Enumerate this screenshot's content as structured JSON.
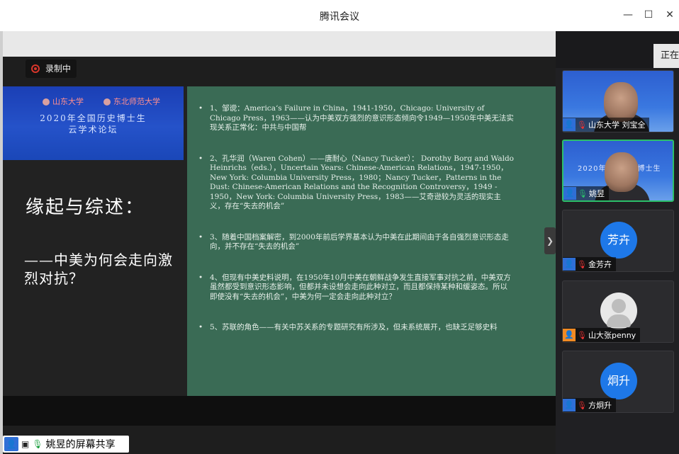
{
  "window": {
    "title": "腾讯会议"
  },
  "recording": {
    "label": "录制中"
  },
  "slide": {
    "banner_logo_left": "山东大学",
    "banner_logo_right": "东北师范大学",
    "banner_line1": "2020年全国历史博士生",
    "banner_line2": "云学术论坛",
    "heading": "缘起与综述：",
    "subheading": "——中美为何会走向激烈对抗？",
    "points": [
      "1、邹谠：America‘s Failure in China，1941-1950，Chicago: University of Chicago Press，1963——认为中美双方强烈的意识形态倾向令1949—1950年中美无法实现关系正常化：中共与中国帮",
      "2、孔华润（Waren Cohen）——唐耐心（Nancy Tucker）： Dorothy Borg and Waldo Heinrichs（eds.），Uncertain Years: Chinese-American Relations，1947-1950，New York: Columbia University Press，1980；Nancy Tucker，Patterns in the Dust: Chinese-American Relations and the Recognition Controversy，1949 - 1950，New York: Columbia University Press，1983——艾奇逊较为灵活的现实主义，存在“失去的机会”",
      "3、随着中国档案解密，到2000年前后学界基本认为中美在此期间由于各自强烈意识形态走向，并不存在“失去的机会”",
      "4、但现有中美史料说明，在1950年10月中美在朝鲜战争发生直接军事对抗之前，中美双方虽然都受到意识形态影响，但都并未设想会走向此种对立，而且都保持某种和缓姿态。所以即使没有“失去的机会”，中美为何一定会走向此种对立？",
      "5、苏联的角色——有关中苏关系的专题研究有所涉及，但未系统展开，也缺乏足够史料"
    ]
  },
  "share": {
    "label": "姚昱的屏幕共享"
  },
  "side_tab": {
    "label": "正在"
  },
  "participants": [
    {
      "name": "山东大学 刘宝全",
      "mic": "muted",
      "type": "video"
    },
    {
      "name": "姚昱",
      "mic": "on",
      "type": "video-banner",
      "video_text": "2020年全国历史博士生"
    },
    {
      "name": "金芳卉",
      "mic": "muted",
      "type": "avatar",
      "avatar_text": "芳卉"
    },
    {
      "name": "山大张penny",
      "mic": "muted",
      "type": "avatar-grey"
    },
    {
      "name": "方炯升",
      "mic": "muted",
      "type": "avatar",
      "avatar_text": "炯升"
    }
  ],
  "colors": {
    "slide_green": "#3a6b55",
    "active_border": "#2cc06a",
    "avatar_blue": "#1e78e8"
  }
}
